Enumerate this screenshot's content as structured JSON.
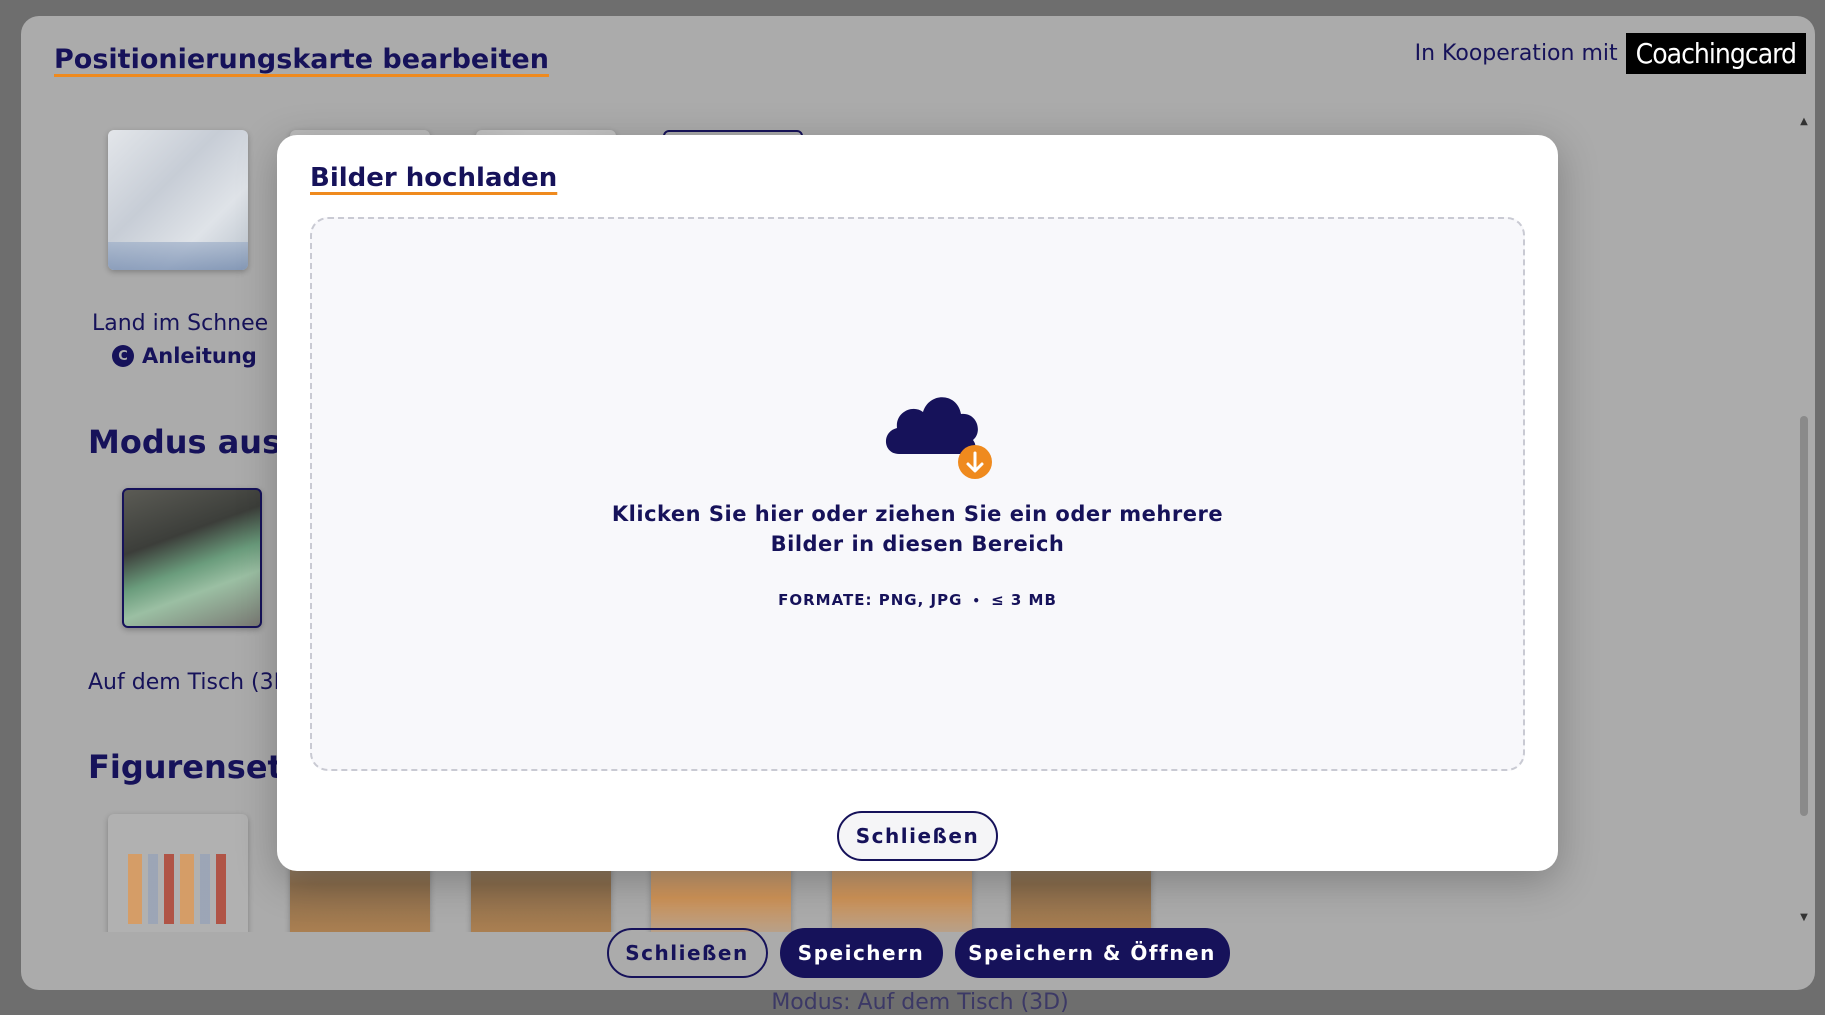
{
  "background": {
    "footer_text": "Modus: Auf dem Tisch (3D)"
  },
  "editor": {
    "title": "Positionierungskarte bearbeiten",
    "cooperation_label": "In Kooperation mit",
    "cooperation_logo": "Coachingcard",
    "cards": {
      "first_label": "Land im Schnee",
      "first_link": "Anleitung",
      "first_link_icon": "c-circle-icon"
    },
    "sections": {
      "mode_heading": "Modus ausw",
      "mode_first_label": "Auf dem Tisch (3D",
      "figures_heading": "Figurenset"
    },
    "actions": {
      "close": "Schließen",
      "save": "Speichern",
      "save_open": "Speichern & Öffnen"
    }
  },
  "modal": {
    "title": "Bilder hochladen",
    "instruction_line1": "Klicken Sie hier oder ziehen Sie ein oder mehrere",
    "instruction_line2": "Bilder in diesen Bereich",
    "formats": "FORMATE: PNG, JPG",
    "size_limit": "≤ 3 MB",
    "close": "Schließen",
    "icon": "cloud-upload-icon"
  },
  "colors": {
    "brand_navy": "#16125a",
    "accent_orange": "#ef8a1e",
    "overlay_gray": "#ababab",
    "modal_bg": "#ffffff"
  }
}
